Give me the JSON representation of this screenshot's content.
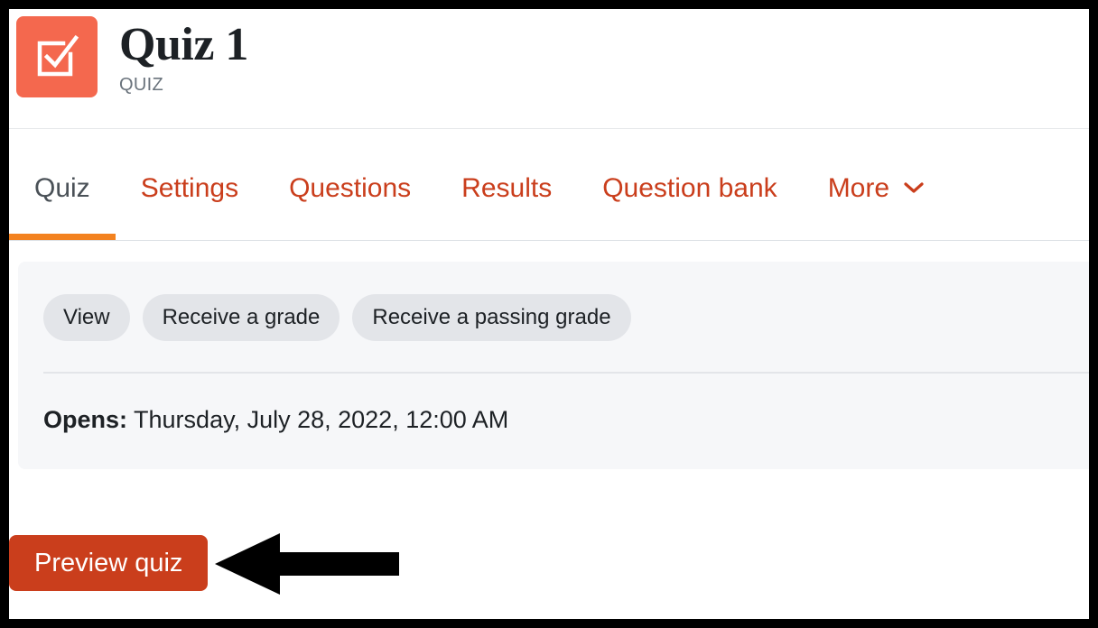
{
  "header": {
    "title": "Quiz 1",
    "activity_type": "QUIZ",
    "icon": "quiz-checkbox-icon",
    "icon_color": "#f4684e"
  },
  "tabs": [
    {
      "label": "Quiz",
      "active": true,
      "has_chevron": false
    },
    {
      "label": "Settings",
      "active": false,
      "has_chevron": false
    },
    {
      "label": "Questions",
      "active": false,
      "has_chevron": false
    },
    {
      "label": "Results",
      "active": false,
      "has_chevron": false
    },
    {
      "label": "Question bank",
      "active": false,
      "has_chevron": false
    },
    {
      "label": "More",
      "active": false,
      "has_chevron": true
    }
  ],
  "activity_card": {
    "completion_pills": [
      {
        "label": "View"
      },
      {
        "label": "Receive a grade"
      },
      {
        "label": "Receive a passing grade"
      }
    ],
    "dates": {
      "label": "Opens:",
      "value": "Thursday, July 28, 2022, 12:00 AM"
    }
  },
  "actions": {
    "preview_quiz_label": "Preview quiz"
  },
  "annotation": {
    "arrow": "left-pointing-arrow",
    "arrow_color": "#000000",
    "points_at": "Preview quiz"
  },
  "colors": {
    "accent_orange": "#f3821f",
    "link_red": "#ca3e1c",
    "icon_coral": "#f4684e",
    "card_bg": "#f6f7f9",
    "pill_bg": "#e3e5e9",
    "text_dark": "#1d2125",
    "text_muted": "#6a737c"
  }
}
